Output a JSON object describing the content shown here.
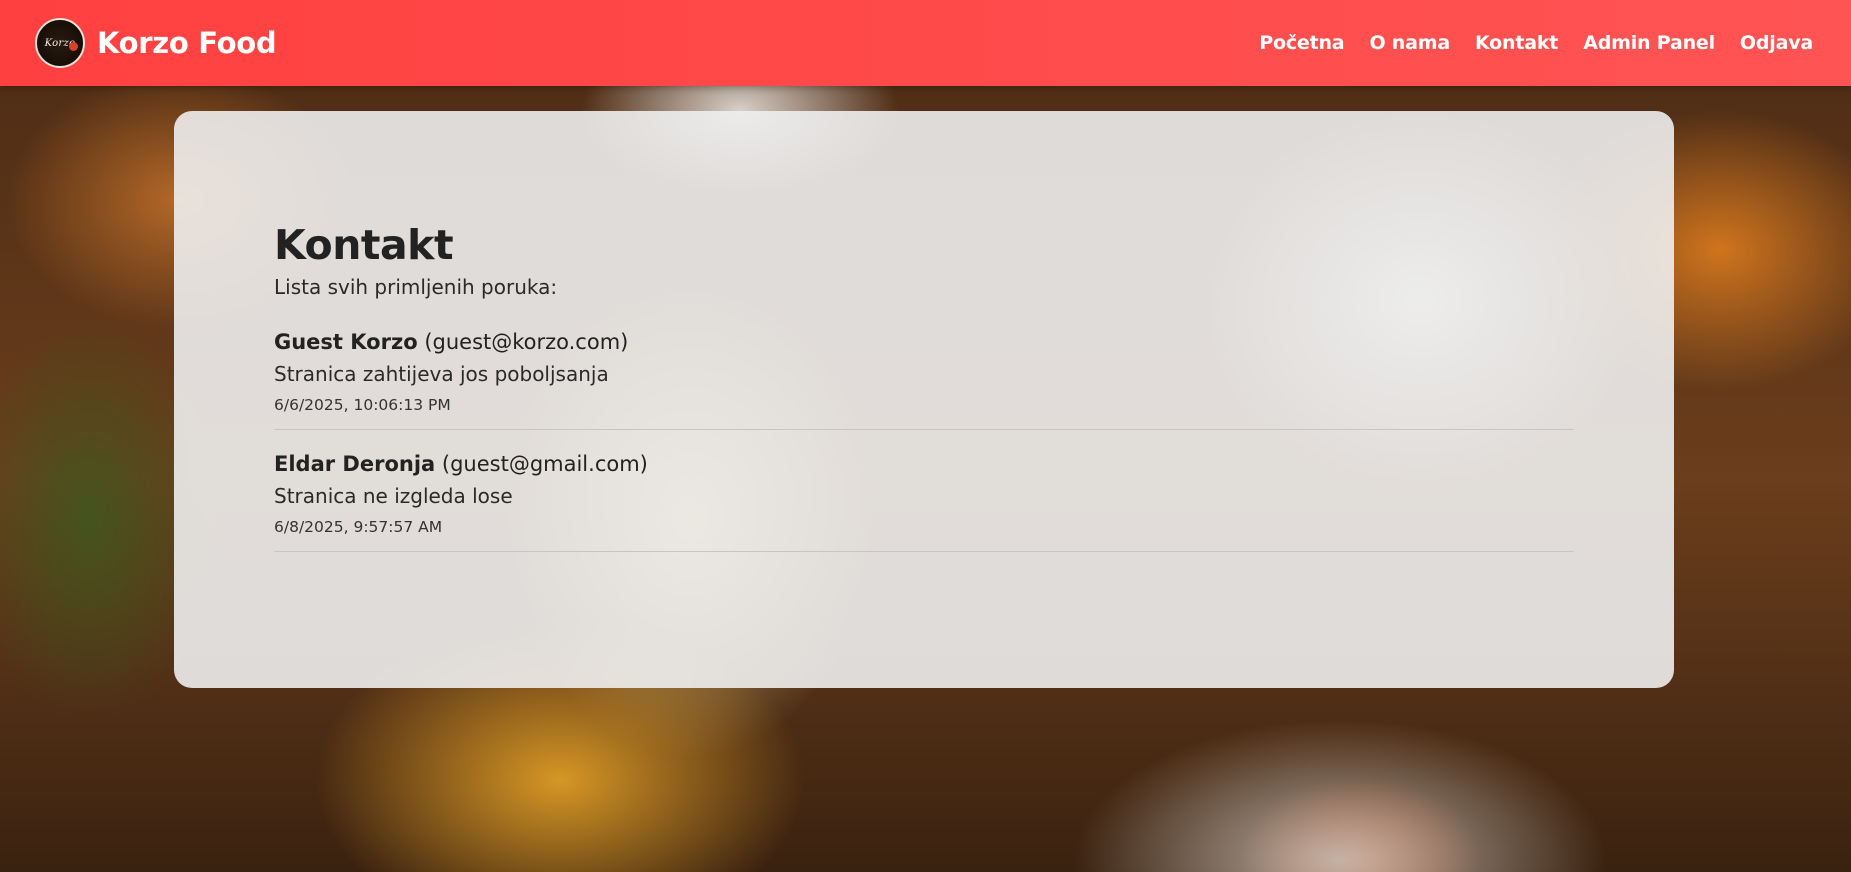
{
  "brand": {
    "name": "Korzo Food",
    "logo_text": "Korzo"
  },
  "nav": {
    "items": [
      {
        "label": "Početna"
      },
      {
        "label": "O nama"
      },
      {
        "label": "Kontakt"
      },
      {
        "label": "Admin Panel"
      },
      {
        "label": "Odjava"
      }
    ]
  },
  "main": {
    "title": "Kontakt",
    "subtitle": "Lista svih primljenih poruka:",
    "messages": [
      {
        "name": "Guest Korzo",
        "email": "(guest@korzo.com)",
        "text": "Stranica zahtijeva jos poboljsanja",
        "date": "6/6/2025, 10:06:13 PM"
      },
      {
        "name": "Eldar Deronja",
        "email": "(guest@gmail.com)",
        "text": "Stranica ne izgleda lose",
        "date": "6/8/2025, 9:57:57 AM"
      }
    ]
  },
  "colors": {
    "navbar": "#ff4a4a",
    "card_bg": "#eeeeee",
    "text": "#222222"
  }
}
